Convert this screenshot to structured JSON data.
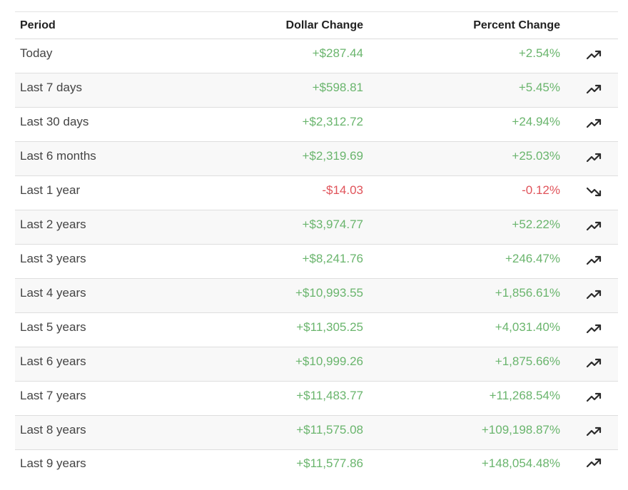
{
  "columns": {
    "period": "Period",
    "dollar": "Dollar Change",
    "percent": "Percent Change"
  },
  "colors": {
    "positive": "#6ab56d",
    "negative": "#e0535a",
    "trend_icon": "#2b2b2b"
  },
  "rows": [
    {
      "period": "Today",
      "dollar": "+$287.44",
      "percent": "+2.54%",
      "direction": "up",
      "trend_icon": "trending-up-icon"
    },
    {
      "period": "Last 7 days",
      "dollar": "+$598.81",
      "percent": "+5.45%",
      "direction": "up",
      "trend_icon": "trending-up-icon"
    },
    {
      "period": "Last 30 days",
      "dollar": "+$2,312.72",
      "percent": "+24.94%",
      "direction": "up",
      "trend_icon": "trending-up-icon"
    },
    {
      "period": "Last 6 months",
      "dollar": "+$2,319.69",
      "percent": "+25.03%",
      "direction": "up",
      "trend_icon": "trending-up-icon"
    },
    {
      "period": "Last 1 year",
      "dollar": "-$14.03",
      "percent": "-0.12%",
      "direction": "down",
      "trend_icon": "trending-down-icon"
    },
    {
      "period": "Last 2 years",
      "dollar": "+$3,974.77",
      "percent": "+52.22%",
      "direction": "up",
      "trend_icon": "trending-up-icon"
    },
    {
      "period": "Last 3 years",
      "dollar": "+$8,241.76",
      "percent": "+246.47%",
      "direction": "up",
      "trend_icon": "trending-up-icon"
    },
    {
      "period": "Last 4 years",
      "dollar": "+$10,993.55",
      "percent": "+1,856.61%",
      "direction": "up",
      "trend_icon": "trending-up-icon"
    },
    {
      "period": "Last 5 years",
      "dollar": "+$11,305.25",
      "percent": "+4,031.40%",
      "direction": "up",
      "trend_icon": "trending-up-icon"
    },
    {
      "period": "Last 6 years",
      "dollar": "+$10,999.26",
      "percent": "+1,875.66%",
      "direction": "up",
      "trend_icon": "trending-up-icon"
    },
    {
      "period": "Last 7 years",
      "dollar": "+$11,483.77",
      "percent": "+11,268.54%",
      "direction": "up",
      "trend_icon": "trending-up-icon"
    },
    {
      "period": "Last 8 years",
      "dollar": "+$11,575.08",
      "percent": "+109,198.87%",
      "direction": "up",
      "trend_icon": "trending-up-icon"
    },
    {
      "period": "Last 9 years",
      "dollar": "+$11,577.86",
      "percent": "+148,054.48%",
      "direction": "up",
      "trend_icon": "trending-up-icon"
    }
  ]
}
